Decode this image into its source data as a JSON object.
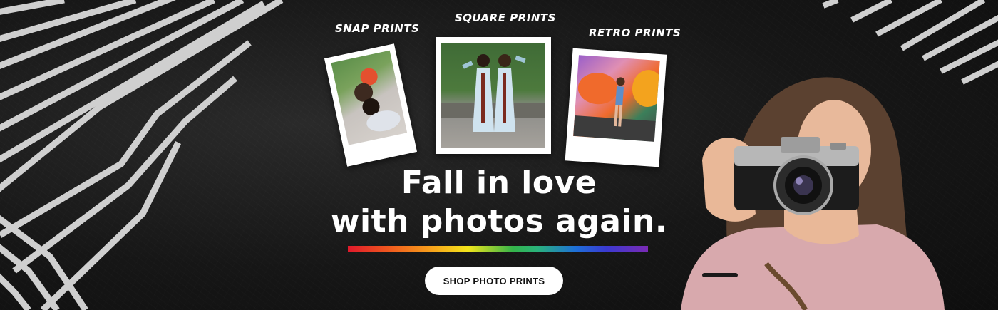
{
  "captions": {
    "snap": "SNAP PRINTS",
    "square": "SQUARE PRINTS",
    "retro": "RETRO PRINTS"
  },
  "headline": {
    "line1": "Fall in love",
    "line2": "with photos again."
  },
  "cta": {
    "label": "SHOP PHOTO PRINTS"
  },
  "colors": {
    "background": "#151515",
    "button": "#ffffff",
    "text": "#ffffff"
  }
}
